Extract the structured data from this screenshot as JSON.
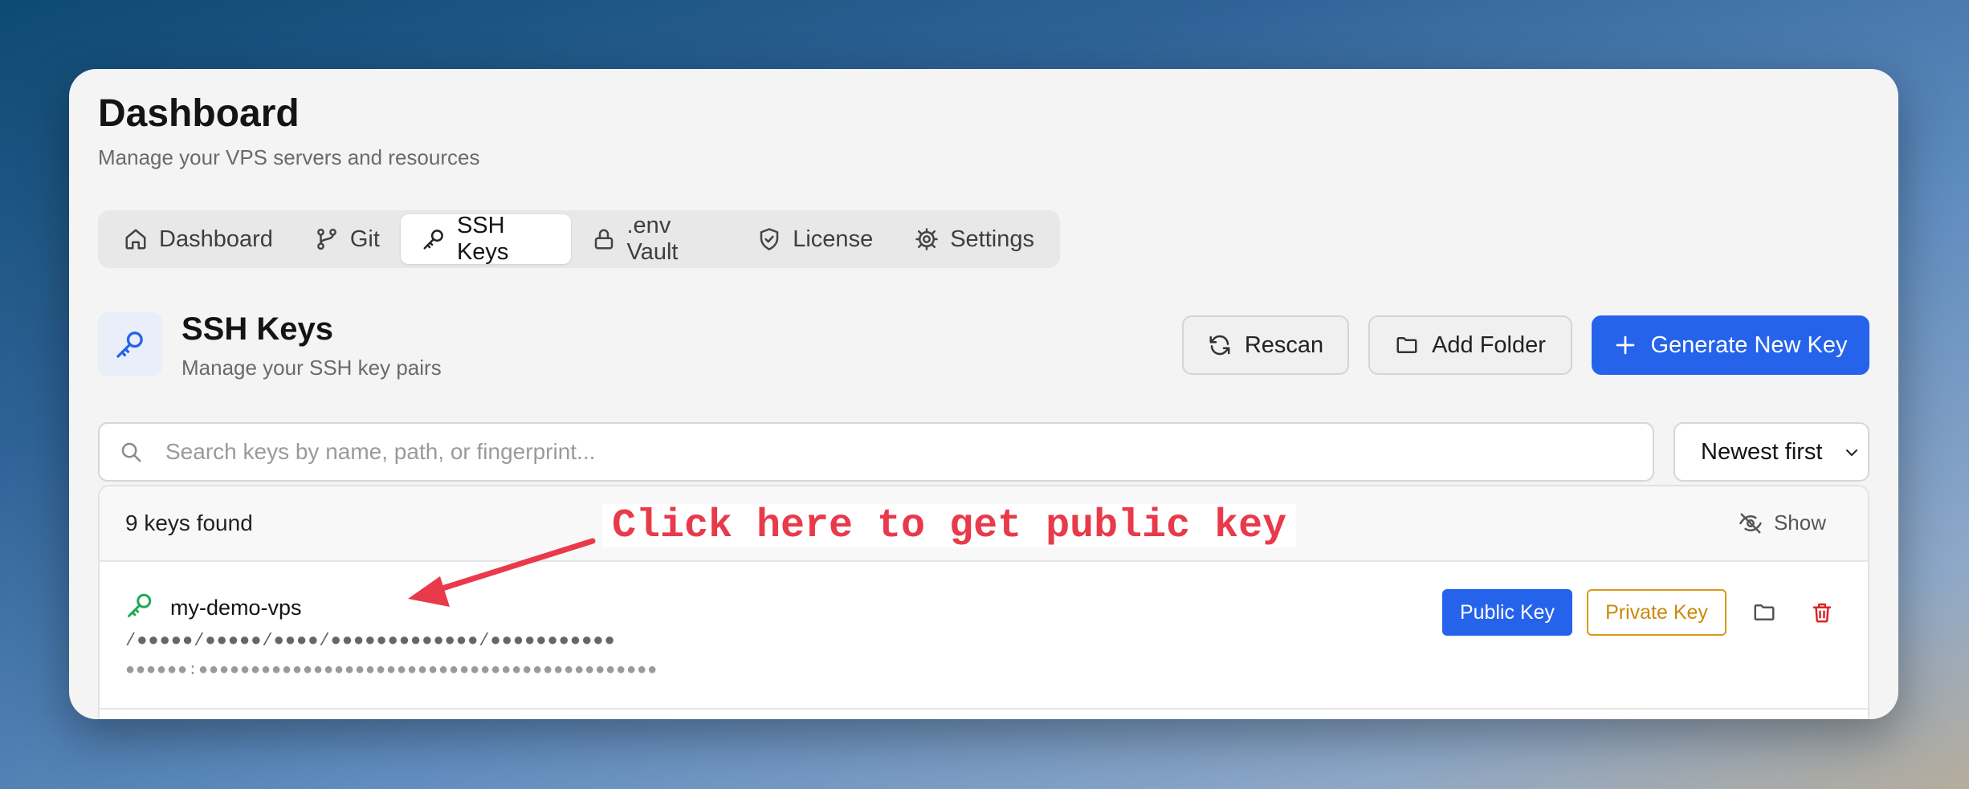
{
  "header": {
    "title": "Dashboard",
    "subtitle": "Manage your VPS servers and resources"
  },
  "tabs": [
    {
      "label": "Dashboard",
      "icon": "home-icon"
    },
    {
      "label": "Git",
      "icon": "git-branch-icon"
    },
    {
      "label": "SSH Keys",
      "icon": "key-icon",
      "active": true
    },
    {
      "label": ".env Vault",
      "icon": "lock-icon"
    },
    {
      "label": "License",
      "icon": "shield-check-icon"
    },
    {
      "label": "Settings",
      "icon": "gear-icon"
    }
  ],
  "section": {
    "title": "SSH Keys",
    "subtitle": "Manage your SSH key pairs"
  },
  "actions": {
    "rescan_label": "Rescan",
    "add_folder_label": "Add Folder",
    "generate_label": "Generate New Key"
  },
  "search": {
    "placeholder": "Search keys by name, path, or fingerprint...",
    "value": ""
  },
  "sort": {
    "selected": "Newest first"
  },
  "list": {
    "count_label": "9 keys found",
    "show_label": "Show",
    "items": [
      {
        "name": "my-demo-vps",
        "path": "/●●●●●/●●●●●/●●●●/●●●●●●●●●●●●●/●●●●●●●●●●●",
        "fingerprint": "●●●●●●:●●●●●●●●●●●●●●●●●●●●●●●●●●●●●●●●●●●●●●●●●●●●",
        "public_key_label": "Public Key",
        "private_key_label": "Private Key"
      }
    ]
  },
  "annotation": {
    "text": "Click here to get public key",
    "color": "#e83a4a"
  },
  "colors": {
    "accent": "#2563eb",
    "key_icon": "#22a855",
    "danger": "#dc2626",
    "warning": "#d99a18"
  }
}
